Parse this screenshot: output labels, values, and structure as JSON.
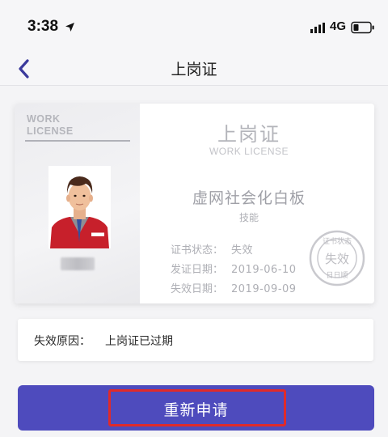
{
  "status_bar": {
    "time": "3:38",
    "network": "4G"
  },
  "nav": {
    "title": "上岗证"
  },
  "license": {
    "left_en_line1": "WORK",
    "left_en_line2": "LICENSE",
    "title": "上岗证",
    "subtitle": "WORK LICENSE",
    "org": "虚网社会化白板",
    "type": "技能",
    "status_label": "证书状态：",
    "status_value": "失效",
    "issue_label": "发证日期：",
    "issue_date": "2019-06-10",
    "expire_label": "失效日期：",
    "expire_date": "2019-09-09",
    "stamp_top": "证书状态",
    "stamp_center": "失效",
    "stamp_bottom": "日日顺",
    "badge_text": "日日顺"
  },
  "reason": {
    "label": "失效原因：",
    "value": "上岗证已过期"
  },
  "actions": {
    "reapply_label": "重新申请"
  },
  "colors": {
    "accent": "#4e4bbd",
    "highlight": "#e02a2a"
  },
  "icons": {
    "back": "chevron-left-icon",
    "location": "location-arrow-icon",
    "signal": "signal-icon",
    "battery": "battery-icon"
  }
}
